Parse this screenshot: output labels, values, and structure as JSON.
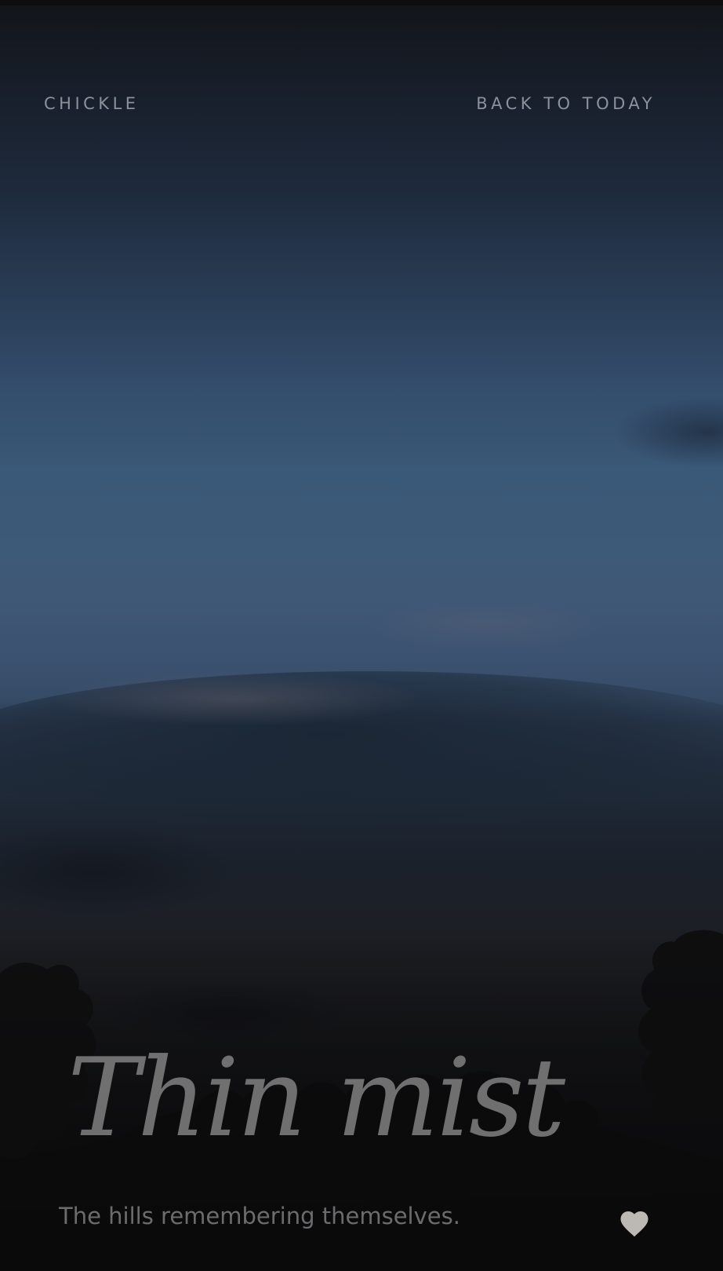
{
  "header": {
    "brand": "CHICKLE",
    "back_link": "BACK TO TODAY"
  },
  "hero": {
    "title": "Thin mist",
    "subtitle": "The hills remembering themselves."
  },
  "actions": {
    "favorite_icon": "heart-icon"
  },
  "colors": {
    "sky_top": "#171d28",
    "sky_mid": "#3d5a78",
    "sky_bottom": "#0a0a0b",
    "text_muted": "#9a9a9c",
    "heart": "#cfcbc6"
  }
}
